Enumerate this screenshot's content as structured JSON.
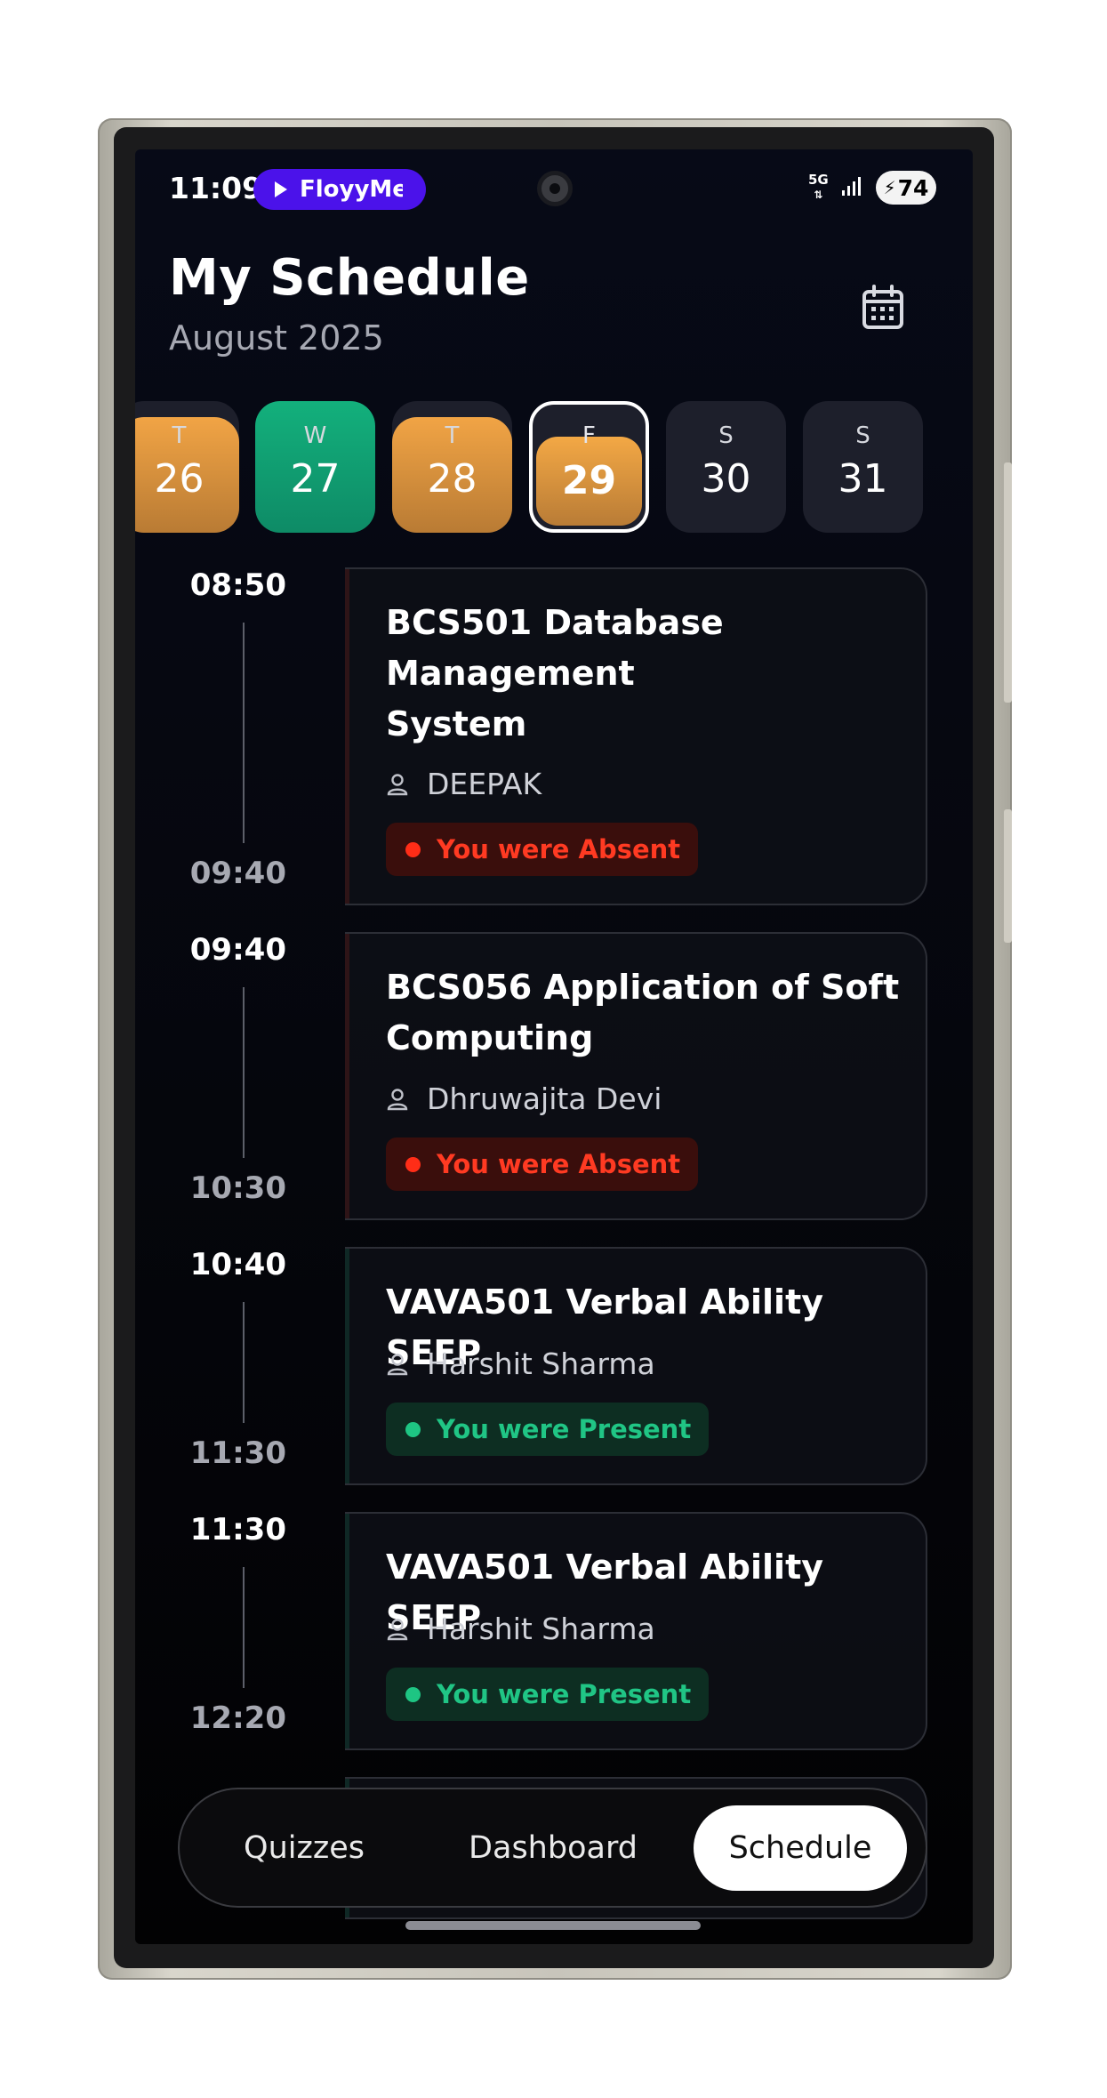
{
  "status_bar": {
    "time": "11:09",
    "media_app": "FloyyMer",
    "network": "5G",
    "battery": "74"
  },
  "header": {
    "title": "My Schedule",
    "subtitle": "August 2025"
  },
  "days": [
    {
      "dow": "T",
      "num": "26",
      "state": "orange"
    },
    {
      "dow": "W",
      "num": "27",
      "state": "green"
    },
    {
      "dow": "T",
      "num": "28",
      "state": "orange"
    },
    {
      "dow": "F",
      "num": "29",
      "state": "selected"
    },
    {
      "dow": "S",
      "num": "30",
      "state": "none"
    },
    {
      "dow": "S",
      "num": "31",
      "state": "none"
    }
  ],
  "classes": [
    {
      "start": "08:50",
      "end": "09:40",
      "title": "BCS501 Database Management System",
      "teacher": "DEEPAK",
      "status": "You were Absent",
      "status_type": "absent"
    },
    {
      "start": "09:40",
      "end": "10:30",
      "title": "BCS056 Application of Soft Computing",
      "teacher": "Dhruwajita Devi",
      "status": "You were Absent",
      "status_type": "absent"
    },
    {
      "start": "10:40",
      "end": "11:30",
      "title": "VAVA501 Verbal Ability SEEP",
      "teacher": "Harshit Sharma",
      "status": "You were Present",
      "status_type": "present"
    },
    {
      "start": "11:30",
      "end": "12:20",
      "title": "VAVA501 Verbal Ability SEEP",
      "teacher": "Harshit Sharma",
      "status": "You were Present",
      "status_type": "present"
    }
  ],
  "nav": {
    "quizzes": "Quizzes",
    "dashboard": "Dashboard",
    "schedule": "Schedule",
    "active": "schedule"
  },
  "colors": {
    "absent": "#ff2d17",
    "present": "#1ec583",
    "orange": "#f1a445",
    "green": "#13b07c",
    "media_pill": "#4b12ea"
  }
}
